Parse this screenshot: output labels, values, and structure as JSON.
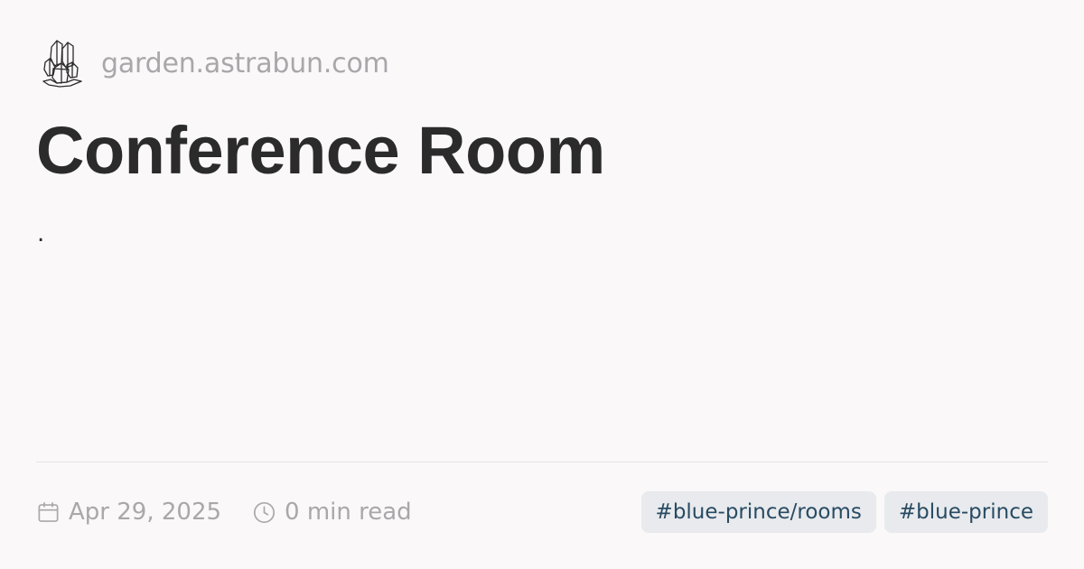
{
  "site": {
    "logo_icon": "crystal-logo-icon",
    "name": "garden.astrabun.com"
  },
  "page": {
    "title": "Conference Room",
    "description": "."
  },
  "meta": {
    "date_icon": "calendar-icon",
    "date": "Apr 29, 2025",
    "reading_icon": "clock-icon",
    "reading_time": "0 min read"
  },
  "tags": [
    "#blue-prince/rooms",
    "#blue-prince"
  ],
  "colors": {
    "background": "#faf8f8",
    "text": "#2b2b2b",
    "muted": "#a8a8aa",
    "tag_background": "#e8eaed",
    "tag_text": "#284b63",
    "divider": "#e4e2e3"
  }
}
